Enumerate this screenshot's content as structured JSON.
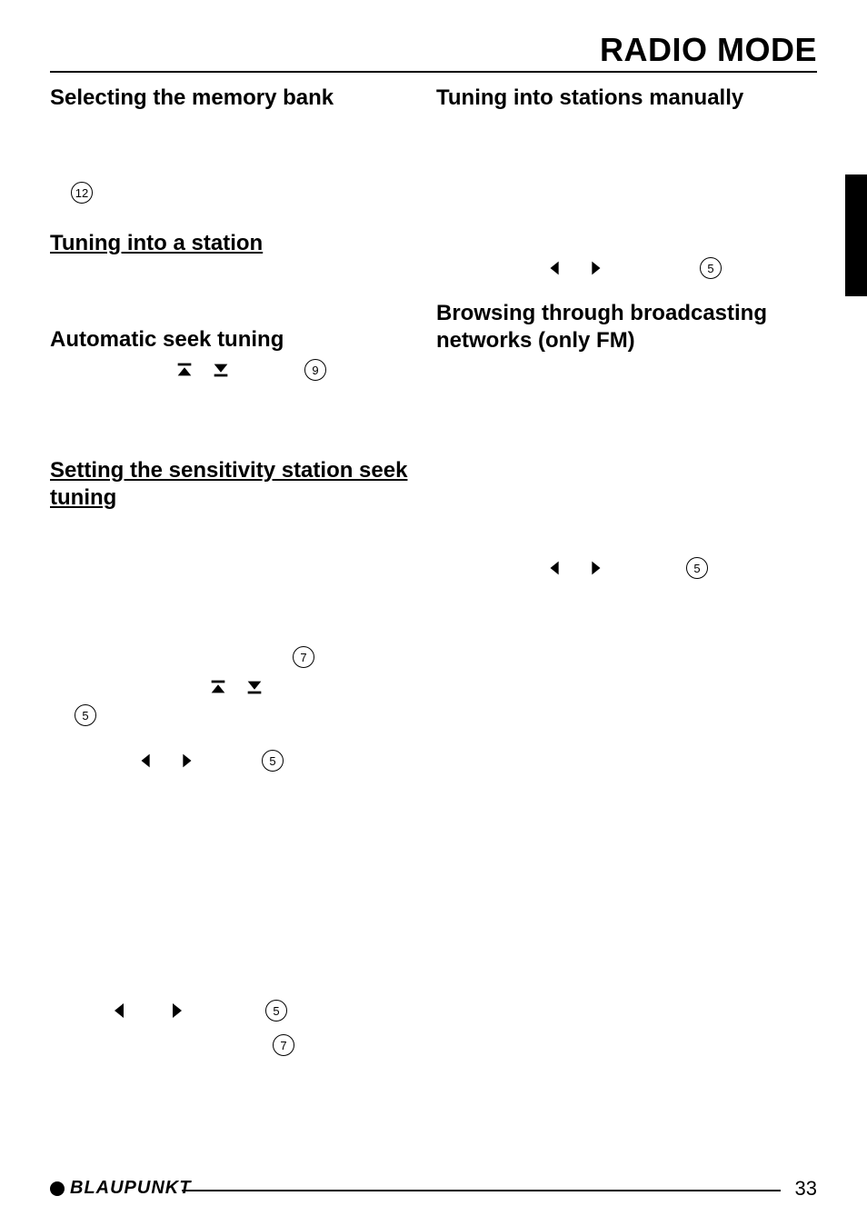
{
  "header": {
    "title": "RADIO MODE"
  },
  "left": {
    "h_memory_bank": "Selecting the memory bank",
    "ref_12": "12",
    "h_tuning_station": "Tuning into a station",
    "h_auto_seek": "Automatic seek tuning",
    "ref_9": "9",
    "h_sensitivity": "Setting the sensitivity station seek tuning",
    "ref_7a": "7",
    "ref_5a": "5",
    "ref_5b": "5",
    "ref_5c": "5",
    "ref_7b": "7"
  },
  "right": {
    "h_manual": "Tuning into stations manually",
    "ref_5a": "5",
    "h_browsing": "Browsing through broadcasting networks (only FM)",
    "ref_5b": "5"
  },
  "footer": {
    "brand": "BLAUPUNKT",
    "page": "33"
  }
}
